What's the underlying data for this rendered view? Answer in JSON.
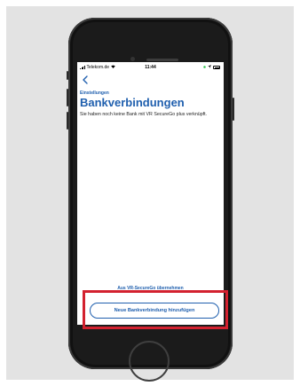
{
  "status_bar": {
    "carrier": "Telekom.de",
    "time": "11:44"
  },
  "nav": {
    "back_icon": "chevron-left-icon"
  },
  "header": {
    "breadcrumb": "Einstellungen",
    "title": "Bankverbindungen"
  },
  "content": {
    "message": "Sie haben noch keine Bank mit VR SecureGo plus verknüpft."
  },
  "actions": {
    "import_link": "Aus VR-SecureGo übernehmen",
    "add_button": "Neue Bankverbindung hinzufügen"
  },
  "colors": {
    "brand": "#1f5fae",
    "highlight": "#d3212f",
    "backdrop": "#e3e3e3"
  }
}
